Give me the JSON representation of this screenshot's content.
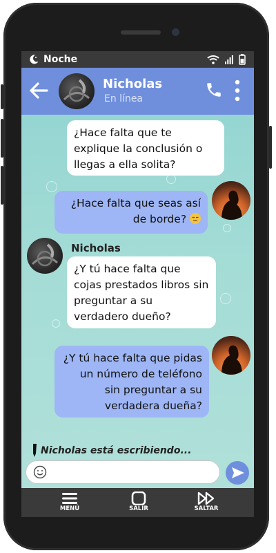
{
  "status_bar": {
    "label": "Noche"
  },
  "header": {
    "name": "Nicholas",
    "status": "En línea"
  },
  "messages": [
    {
      "from": "Nicholas",
      "text": "¿Hace falta que te explique la conclusión o llegas a ella solita?"
    },
    {
      "from": "me",
      "text": "¿Hace falta que seas así de borde?"
    },
    {
      "from": "Nicholas",
      "sender_label": "Nicholas",
      "text": "¿Y tú hace falta que cojas prestados libros sin preguntar a su verdadero dueño?"
    },
    {
      "from": "me",
      "text": "¿Y tú hace falta que pidas un número de teléfono sin preguntar a su verdadera dueña?"
    }
  ],
  "typing_indicator": "Nicholas está escribiendo...",
  "composer": {
    "value": "",
    "placeholder": ""
  },
  "nav": {
    "menu": "MENÚ",
    "exit": "SALIR",
    "skip": "SALTAR"
  },
  "colors": {
    "header": "#6f8fdd",
    "my_bubble": "#9eb6f5",
    "their_bubble": "#ffffff",
    "bars": "#3a3a3a",
    "background": "#a4dcd6"
  },
  "icons": [
    "moon-icon",
    "wifi-icon",
    "signal-icon",
    "battery-icon",
    "back-arrow-icon",
    "phone-icon",
    "more-icon",
    "pen-icon",
    "smile-icon",
    "send-icon",
    "menu-icon",
    "exit-icon",
    "skip-icon"
  ]
}
